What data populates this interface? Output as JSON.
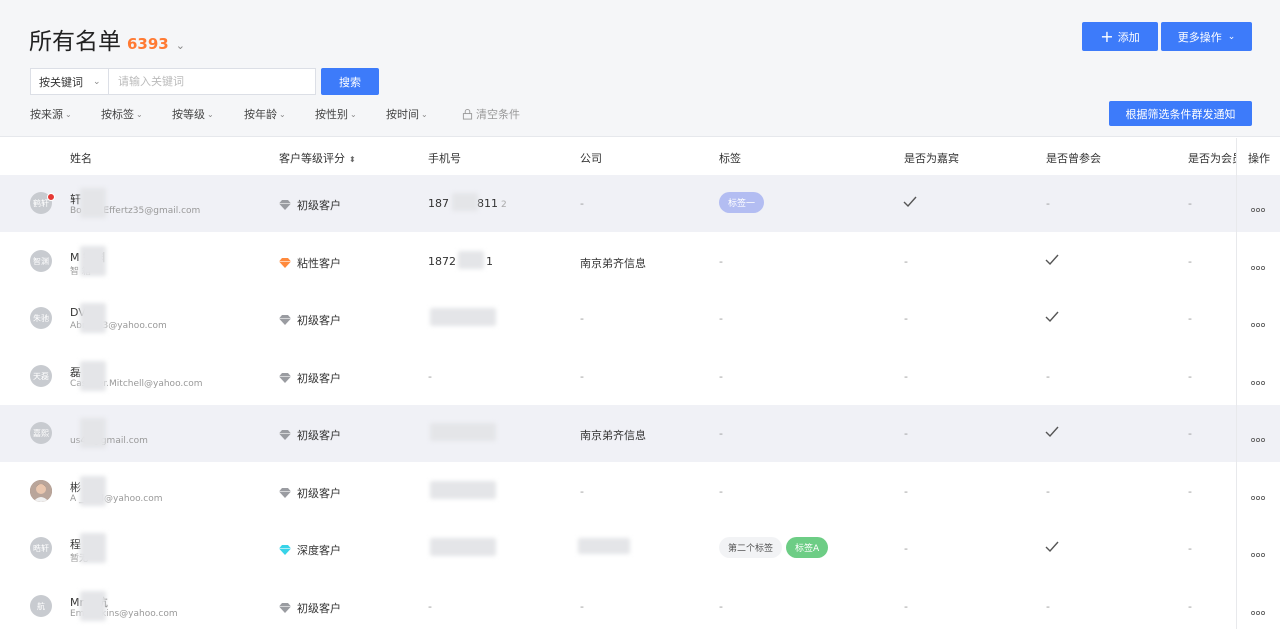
{
  "header": {
    "title": "所有名单",
    "count": "6393",
    "title_caret": "⌄",
    "add_label": "添加",
    "more_label": "更多操作",
    "notify_label": "根据筛选条件群发通知"
  },
  "search": {
    "select_value": "按关键词",
    "placeholder": "请输入关键词",
    "button_label": "搜索"
  },
  "filters": [
    "按来源",
    "按标签",
    "按等级",
    "按年龄",
    "按性别",
    "按时间"
  ],
  "clear_label": "清空条件",
  "columns": {
    "name": "姓名",
    "level": "客户等级评分",
    "phone": "手机号",
    "company": "公司",
    "tags": "标签",
    "vip": "是否为嘉宾",
    "attended": "是否曾参会",
    "member": "是否为会员",
    "ops": "操作"
  },
  "dash": "-",
  "rows": [
    {
      "avatar": "鹤轩",
      "name": "轩",
      "email": "Bo   ace.Effertz35@gmail.com",
      "level": "初级客户",
      "gem": "grey",
      "phone": "187",
      "phone_tail": "811",
      "phone_extra": "2",
      "company": "",
      "tags": [
        "标签一"
      ],
      "vip": true,
      "attended": false
    },
    {
      "avatar": "智渊",
      "name": "M    智渊",
      "email": "智   箱",
      "level": "粘性客户",
      "gem": "orange",
      "phone": "1872",
      "phone_tail": "1",
      "phone_extra": "",
      "company": "南京弟齐信息",
      "tags": [],
      "vip": false,
      "attended": true
    },
    {
      "avatar": "朱驰",
      "name": "   DVM",
      "email": "Abner53@yahoo.com",
      "level": "初级客户",
      "gem": "grey",
      "phone": "",
      "phone_tail": "",
      "phone_extra": "",
      "company": "",
      "tags": [],
      "vip": false,
      "attended": true
    },
    {
      "avatar": "天磊",
      "name": "   磊",
      "email": "Casimer.Mitchell@yahoo.com",
      "level": "初级客户",
      "gem": "grey",
      "phone": "",
      "phone_tail": "",
      "phone_extra": "",
      "company": "",
      "tags": [],
      "vip": false,
      "attended": false
    },
    {
      "avatar": "嘉熙",
      "name": "   ",
      "email": "   us45@gmail.com",
      "level": "初级客户",
      "gem": "grey",
      "phone": "",
      "phone_tail": "",
      "phone_extra": "",
      "company": "南京弟齐信息",
      "tags": [],
      "vip": false,
      "attended": true
    },
    {
      "avatar": "",
      "name": "   彬",
      "email": "A   _Huel@yahoo.com",
      "level": "初级客户",
      "gem": "grey",
      "phone": "",
      "phone_tail": "",
      "phone_extra": "",
      "company": "",
      "tags": [],
      "vip": false,
      "attended": false
    },
    {
      "avatar": "晧轩",
      "name": "程",
      "email": "暂无",
      "level": "深度客户",
      "gem": "cyan",
      "phone": "",
      "phone_tail": "",
      "phone_extra": "",
      "company": "",
      "tags": [
        "第二个标签",
        "标签A"
      ],
      "vip": false,
      "attended": true
    },
    {
      "avatar": "航",
      "name": "Mrs.   杭",
      "email": "Emel   nkins@yahoo.com",
      "level": "初级客户",
      "gem": "grey",
      "phone": "",
      "phone_tail": "",
      "phone_extra": "",
      "company": "",
      "tags": [],
      "vip": false,
      "attended": false
    }
  ],
  "colors": {
    "accent": "#3d7bfa",
    "count": "#ff7a33",
    "highlight_row": "#f0f1f6"
  }
}
